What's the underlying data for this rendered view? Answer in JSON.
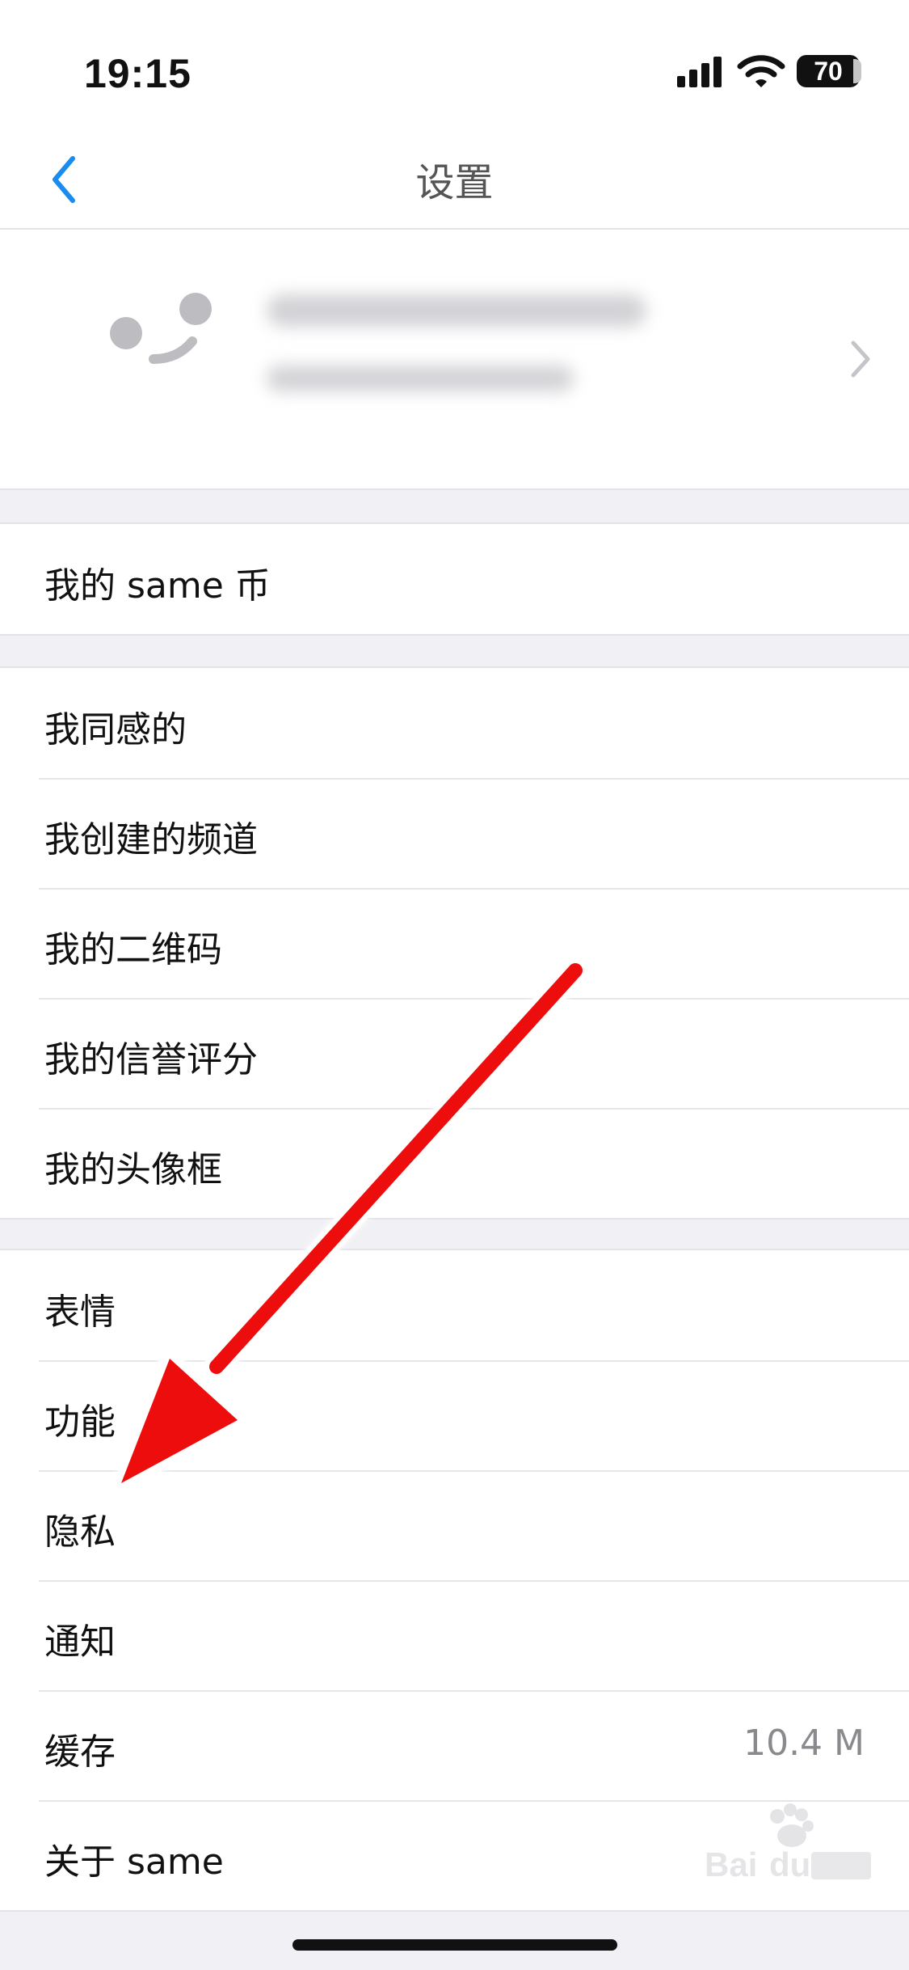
{
  "status_bar": {
    "time": "19:15",
    "battery": "70"
  },
  "nav": {
    "title": "设置"
  },
  "groups": [
    [
      {
        "label": "我的 same 币"
      }
    ],
    [
      {
        "label": "我同感的"
      },
      {
        "label": "我创建的频道"
      },
      {
        "label": "我的二维码"
      },
      {
        "label": "我的信誉评分"
      },
      {
        "label": "我的头像框"
      }
    ],
    [
      {
        "label": "表情"
      },
      {
        "label": "功能"
      },
      {
        "label": "隐私"
      },
      {
        "label": "通知"
      },
      {
        "label": "缓存",
        "value": "10.4 M"
      },
      {
        "label": "关于 same"
      }
    ]
  ],
  "icons": {
    "back": "chevron-left-icon",
    "profile_chevron": "chevron-right-icon",
    "signal": "cellular-signal-icon",
    "wifi": "wifi-icon"
  },
  "colors": {
    "accent": "#1a8cf0",
    "annotation_arrow": "#ee1111"
  }
}
